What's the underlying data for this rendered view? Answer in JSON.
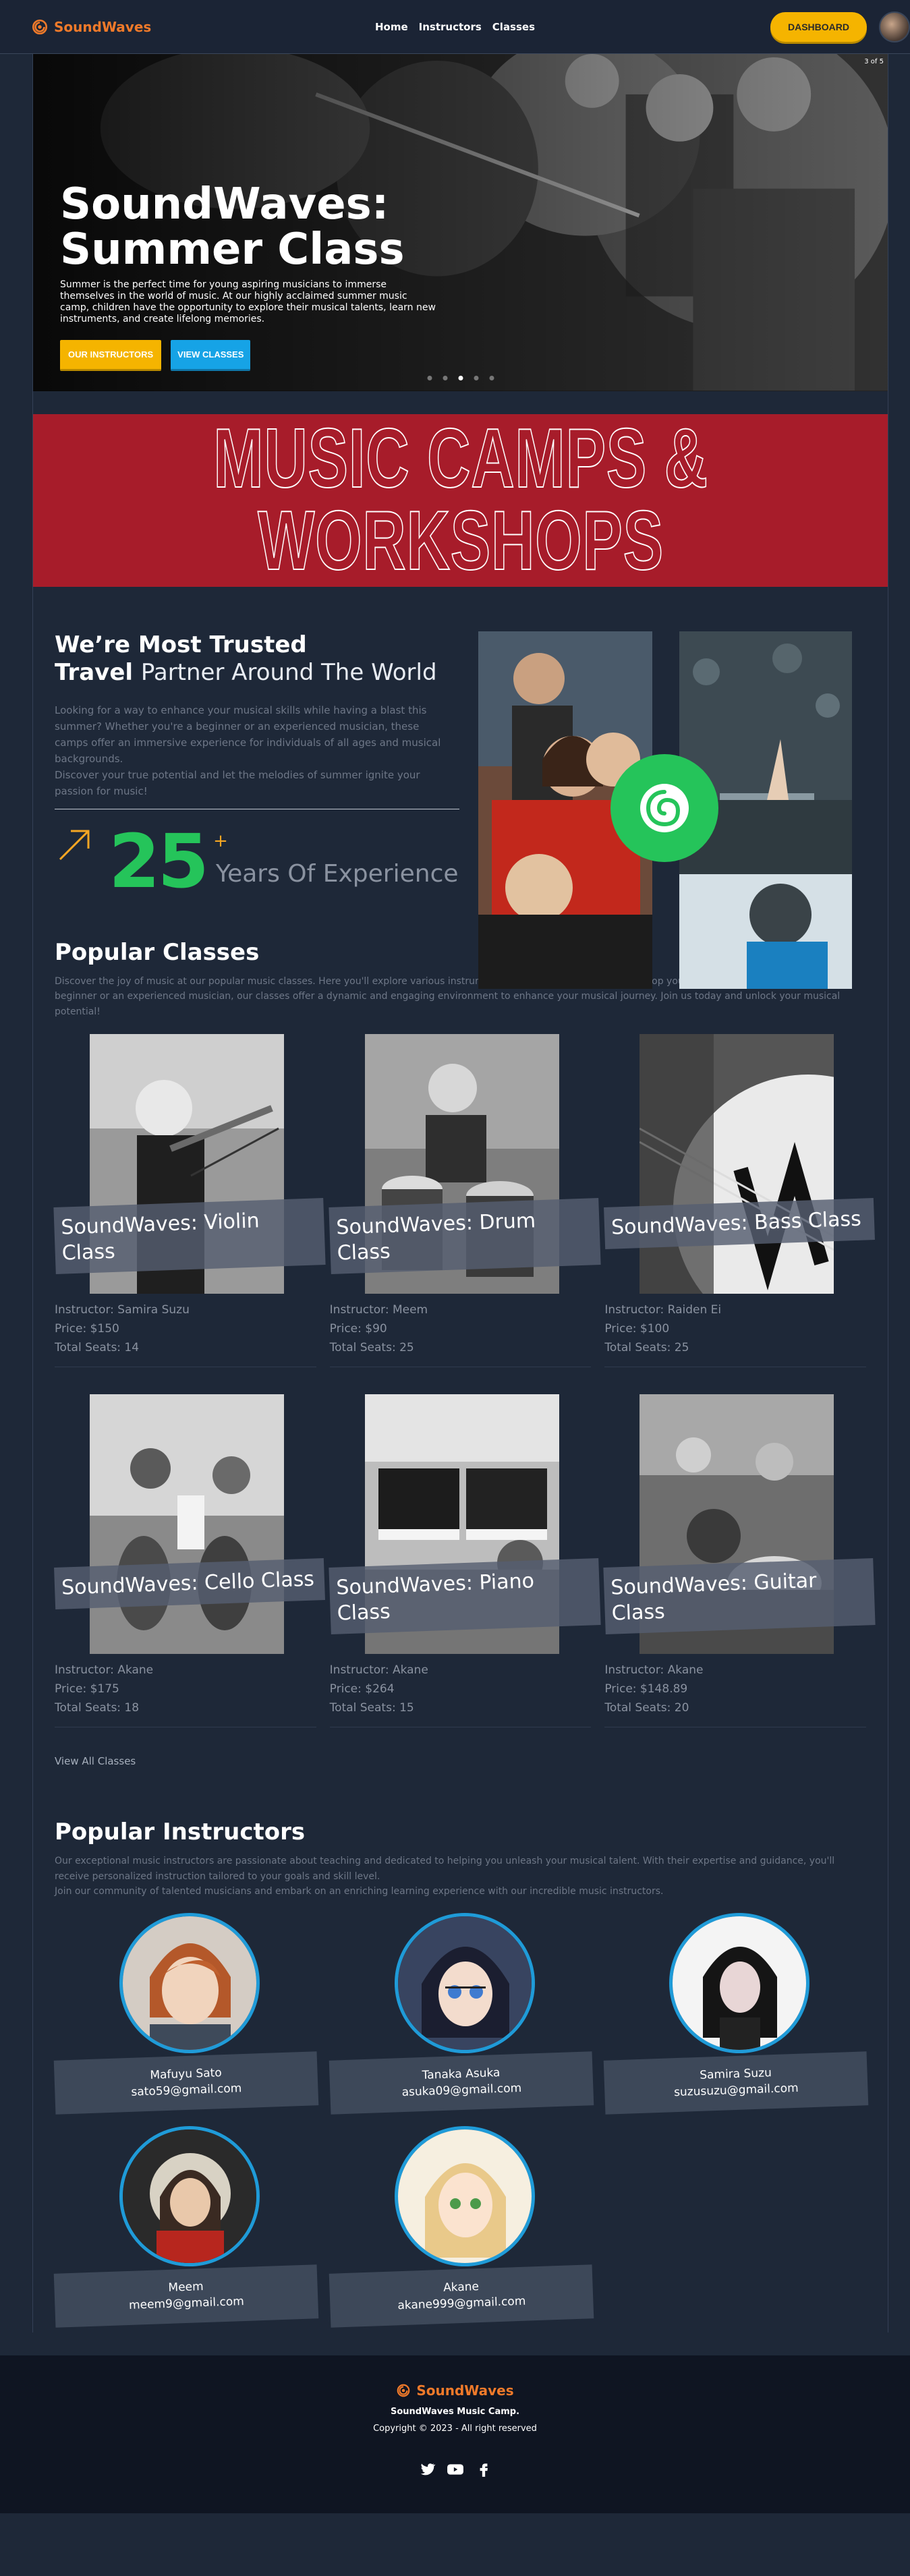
{
  "nav": {
    "brand": "SoundWaves",
    "links": [
      "Home",
      "Instructors",
      "Classes"
    ],
    "dashboard": "DASHBOARD"
  },
  "hero": {
    "counter": "3 of 5",
    "title": "SoundWaves: Summer Class",
    "description": "Summer is the perfect time for young aspiring musicians to immerse themselves in the world of music. At our highly acclaimed summer music camp, children have the opportunity to explore their musical talents, learn new instruments, and create lifelong memories.",
    "btn_instructors": "OUR INSTRUCTORS",
    "btn_classes": "VIEW CLASSES"
  },
  "banner": {
    "text": "MUSIC CAMPS & WORKSHOPS"
  },
  "about": {
    "heading_bold_1": "We’re Most Trusted",
    "heading_bold_2": "Travel",
    "heading_thin": "Partner Around The World",
    "text": "Looking for a way to enhance your musical skills while having a blast this summer? Whether you're a beginner or an experienced musician, these camps offer an immersive experience for individuals of all ages and musical backgrounds.",
    "text2": "Discover your true potential and let the melodies of summer ignite your passion for music!",
    "years": "25",
    "plus": "+",
    "years_label": "Years Of Experience"
  },
  "classes": {
    "title": "Popular Classes",
    "description": "Discover the joy of music at our popular music classes. Here you'll explore various instruments, learn music theory, and develop your musical skills. Whether you're a beginner or an experienced musician, our classes offer a dynamic and engaging environment to enhance your musical journey. Join us today and unlock your musical potential!",
    "items": [
      {
        "name": "SoundWaves: Violin Class",
        "instructor": "Instructor: Samira Suzu",
        "price": "Price: $150",
        "seats": "Total Seats: 14"
      },
      {
        "name": "SoundWaves: Drum Class",
        "instructor": "Instructor: Meem",
        "price": "Price: $90",
        "seats": "Total Seats: 25"
      },
      {
        "name": "SoundWaves: Bass Class",
        "instructor": "Instructor: Raiden Ei",
        "price": "Price: $100",
        "seats": "Total Seats: 25"
      },
      {
        "name": "SoundWaves: Cello Class",
        "instructor": "Instructor: Akane",
        "price": "Price: $175",
        "seats": "Total Seats: 18"
      },
      {
        "name": "SoundWaves: Piano Class",
        "instructor": "Instructor: Akane",
        "price": "Price: $264",
        "seats": "Total Seats: 15"
      },
      {
        "name": "SoundWaves: Guitar Class",
        "instructor": "Instructor: Akane",
        "price": "Price: $148.89",
        "seats": "Total Seats: 20"
      }
    ],
    "view_all": "View All Classes"
  },
  "instructors": {
    "title": "Popular Instructors",
    "description": "Our exceptional music instructors are passionate about teaching and dedicated to helping you unleash your musical talent. With their expertise and guidance, you'll receive personalized instruction tailored to your goals and skill level.",
    "description2": "Join our community of talented musicians and embark on an enriching learning experience with our incredible music instructors.",
    "items": [
      {
        "name": "Mafuyu Sato",
        "email": "sato59@gmail.com"
      },
      {
        "name": "Tanaka Asuka",
        "email": "asuka09@gmail.com"
      },
      {
        "name": "Samira Suzu",
        "email": "suzusuzu@gmail.com"
      },
      {
        "name": "Meem",
        "email": "meem9@gmail.com"
      },
      {
        "name": "Akane",
        "email": "akane999@gmail.com"
      }
    ]
  },
  "footer": {
    "brand": "SoundWaves",
    "camp": "SoundWaves Music Camp.",
    "copyright": "Copyright © 2023 - All right reserved"
  },
  "colors": {
    "brand_orange": "#f07a2a",
    "accent_yellow": "#f5b400",
    "accent_blue": "#16a3e6",
    "banner_red": "#a71c2a",
    "green": "#25c45a",
    "background": "#1e2838"
  },
  "icons": [
    "logo-icon",
    "arrow-up-right-icon",
    "spiral-icon",
    "twitter-icon",
    "youtube-icon",
    "facebook-icon"
  ]
}
